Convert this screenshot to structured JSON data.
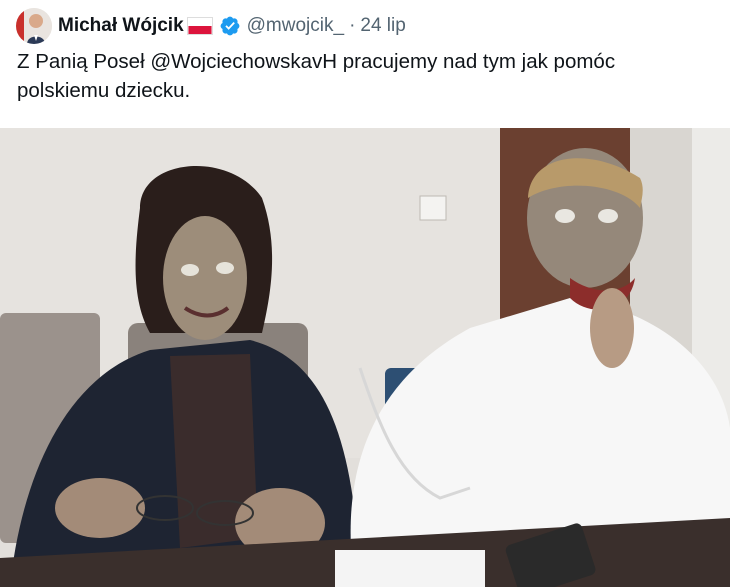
{
  "tweet": {
    "author_name": "Michał Wójcik",
    "handle": "@mwojcik_",
    "separator": "·",
    "date": "24 lip",
    "text": "Z Panią Poseł @WojciechowskavH pracujemy nad tym jak pomóc polskiemu dziecku."
  },
  "icons": {
    "flag": "poland-flag-icon",
    "verified": "verified-badge-icon"
  },
  "colors": {
    "verified_blue": "#1d9bf0",
    "secondary_text": "#536471",
    "primary_text": "#0f1419"
  }
}
